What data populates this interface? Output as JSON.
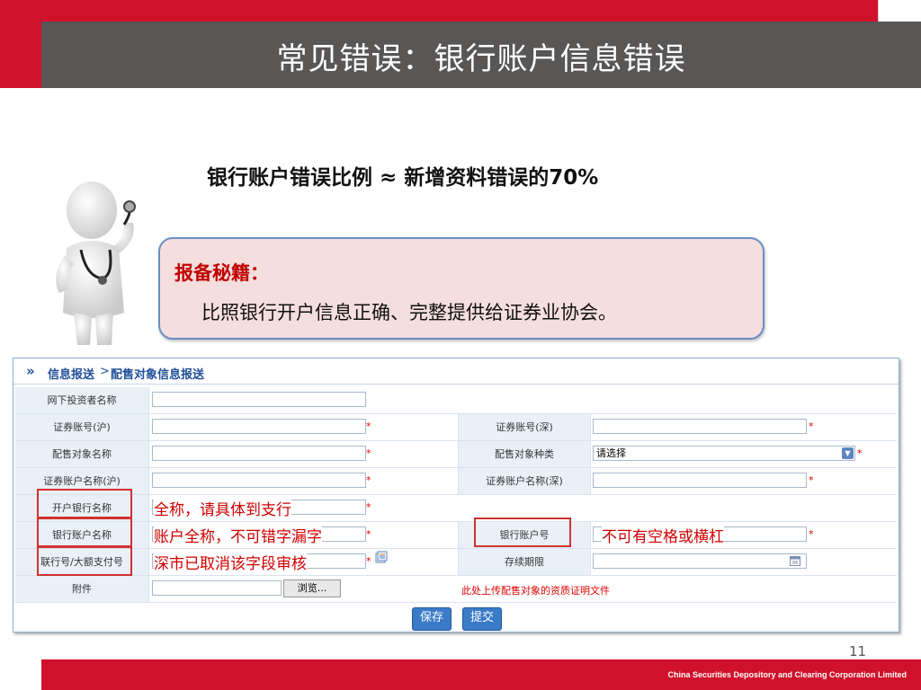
{
  "slide": {
    "title": "常见错误：银行账户信息错误",
    "headline": "银行账户错误比例 ≈ 新增资料错误的70%",
    "tips_title": "报备秘籍：",
    "tips_body": "比照银行开户信息正确、完整提供给证券业协会。",
    "page_number": "11",
    "footer": "China Securities Depository and Clearing Corporation Limited"
  },
  "form": {
    "breadcrumb": {
      "arrow": "»",
      "level1": "信息报送",
      "separator": ">",
      "level2": "配售对象信息报送"
    },
    "labels": {
      "investor_name": "网下投资者名称",
      "account_sh": "证券账号(沪)",
      "account_sz": "证券账号(深)",
      "target_name": "配售对象名称",
      "target_type": "配售对象种类",
      "account_name_sh": "证券账户名称(沪)",
      "account_name_sz": "证券账户名称(深)",
      "bank_name": "开户银行名称",
      "bank_account_name": "银行账户名称",
      "bank_account_no": "银行账户号",
      "clearing_no": "联行号/大额支付号",
      "duration": "存续期限",
      "attachment": "附件"
    },
    "required_mark": "*",
    "select_value": "请选择",
    "browse_label": "浏览...",
    "upload_hint": "此处上传配售对象的资质证明文件",
    "save_label": "保存",
    "submit_label": "提交"
  },
  "annotations": {
    "bank_name_note": "全称，请具体到支行",
    "bank_account_name_note": "账户全称，不可错字漏字",
    "bank_account_no_note": "不可有空格或横杠",
    "clearing_no_note": "深市已取消该字段审核"
  },
  "colors": {
    "brand_red": "#d0112b",
    "title_bar": "#595656",
    "annotation_red": "#d00000"
  }
}
